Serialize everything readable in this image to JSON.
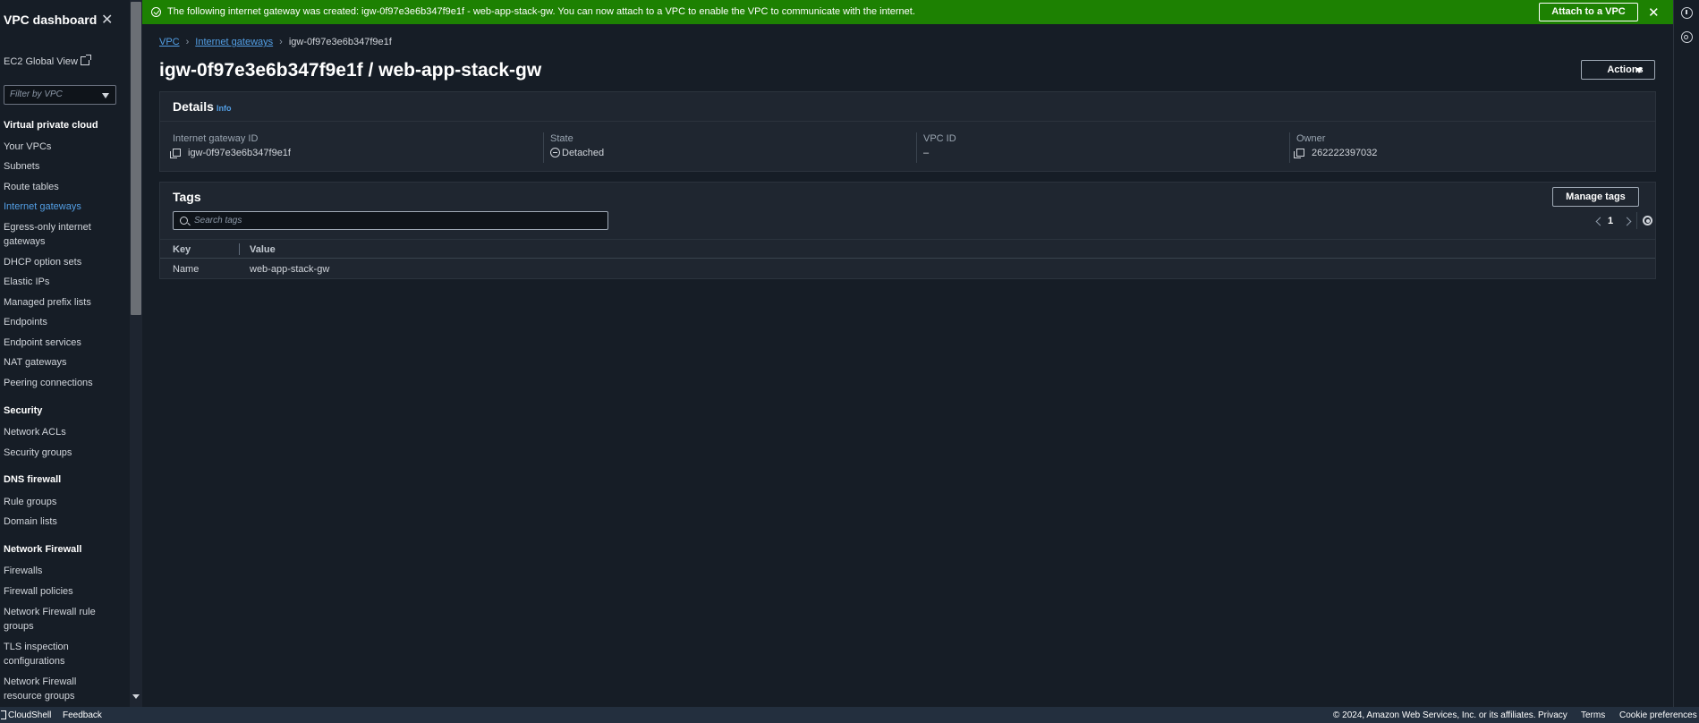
{
  "sidebar": {
    "title": "VPC dashboard",
    "close": "✕",
    "global_view": "EC2 Global View",
    "filter_placeholder": "Filter by VPC",
    "sections": {
      "vpc": "Virtual private cloud",
      "security": "Security",
      "dns_firewall": "DNS firewall",
      "network_firewall": "Network Firewall"
    },
    "items": {
      "your_vpcs": "Your VPCs",
      "subnets": "Subnets",
      "route_tables": "Route tables",
      "internet_gateways": "Internet gateways",
      "egress_only": "Egress-only internet gateways",
      "dhcp": "DHCP option sets",
      "elastic_ips": "Elastic IPs",
      "prefix_lists": "Managed prefix lists",
      "endpoints": "Endpoints",
      "endpoint_services": "Endpoint services",
      "nat_gateways": "NAT gateways",
      "peering": "Peering connections",
      "network_acls": "Network ACLs",
      "security_groups": "Security groups",
      "rule_groups": "Rule groups",
      "domain_lists": "Domain lists",
      "firewalls": "Firewalls",
      "firewall_policies": "Firewall policies",
      "nf_rule_groups": "Network Firewall rule groups",
      "tls_inspection": "TLS inspection configurations",
      "nf_resource_groups": "Network Firewall resource groups"
    }
  },
  "banner": {
    "message": "The following internet gateway was created: igw-0f97e3e6b347f9e1f - web-app-stack-gw. You can now attach to a VPC to enable the VPC to communicate with the internet.",
    "attach_label": "Attach to a VPC",
    "close": "✕",
    "color": "#1d8102"
  },
  "breadcrumb": {
    "vpc": "VPC",
    "internet_gateways": "Internet gateways",
    "current": "igw-0f97e3e6b347f9e1f"
  },
  "page": {
    "title": "igw-0f97e3e6b347f9e1f / web-app-stack-gw",
    "actions_label": "Actions"
  },
  "details": {
    "header": "Details",
    "info": "Info",
    "igw_id_label": "Internet gateway ID",
    "igw_id": "igw-0f97e3e6b347f9e1f",
    "state_label": "State",
    "state": "Detached",
    "vpc_id_label": "VPC ID",
    "vpc_id": "–",
    "owner_label": "Owner",
    "owner": "262222397032"
  },
  "tags": {
    "header": "Tags",
    "manage_label": "Manage tags",
    "search_placeholder": "Search tags",
    "page": "1",
    "columns": {
      "key": "Key",
      "value": "Value"
    },
    "rows": [
      {
        "key": "Name",
        "value": "web-app-stack-gw"
      }
    ]
  },
  "footer": {
    "cloudshell": "CloudShell",
    "feedback": "Feedback",
    "copyright": "© 2024, Amazon Web Services, Inc. or its affiliates.",
    "privacy": "Privacy",
    "terms": "Terms",
    "cookies": "Cookie preferences"
  },
  "colors": {
    "link": "#539fe5",
    "success": "#1d8102",
    "background": "#161d26"
  }
}
